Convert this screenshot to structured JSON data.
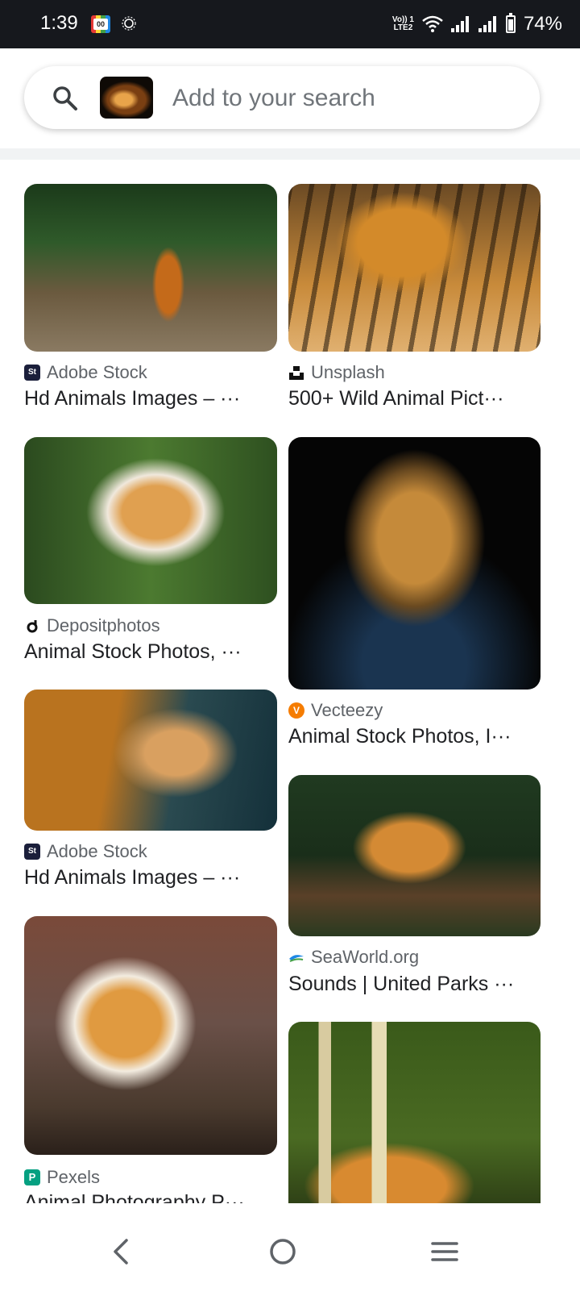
{
  "status_bar": {
    "time": "1:39",
    "battery": "74%",
    "volte_top": "Vo)) 1",
    "volte_bottom": "LTE2"
  },
  "search": {
    "placeholder": "Add to your search",
    "value": ""
  },
  "results_left": [
    {
      "source": "Adobe Stock",
      "title": "Hd Animals Images – ···",
      "favicon_color": "#1b1f3b",
      "favicon_text": "St"
    },
    {
      "source": "Depositphotos",
      "title": "Animal Stock Photos, ···",
      "favicon_color": "#ffffff",
      "favicon_text": ""
    },
    {
      "source": "Adobe Stock",
      "title": "Hd Animals Images – ···",
      "favicon_color": "#1b1f3b",
      "favicon_text": "St"
    },
    {
      "source": "Pexels",
      "title": "Animal Photography P···",
      "favicon_color": "#05a081",
      "favicon_text": "P"
    }
  ],
  "results_right": [
    {
      "source": "Unsplash",
      "title": "500+ Wild Animal Pict···",
      "favicon_color": "#111111",
      "favicon_text": ""
    },
    {
      "source": "Vecteezy",
      "title": "Animal Stock Photos, I···",
      "favicon_color": "#f57c00",
      "favicon_text": "V"
    },
    {
      "source": "SeaWorld.org",
      "title": "Sounds | United Parks ···",
      "favicon_color": "#1e88e5",
      "favicon_text": ""
    }
  ],
  "icons": {
    "search": "search-icon",
    "back": "back-icon",
    "home": "home-icon",
    "recents": "menu-icon"
  }
}
